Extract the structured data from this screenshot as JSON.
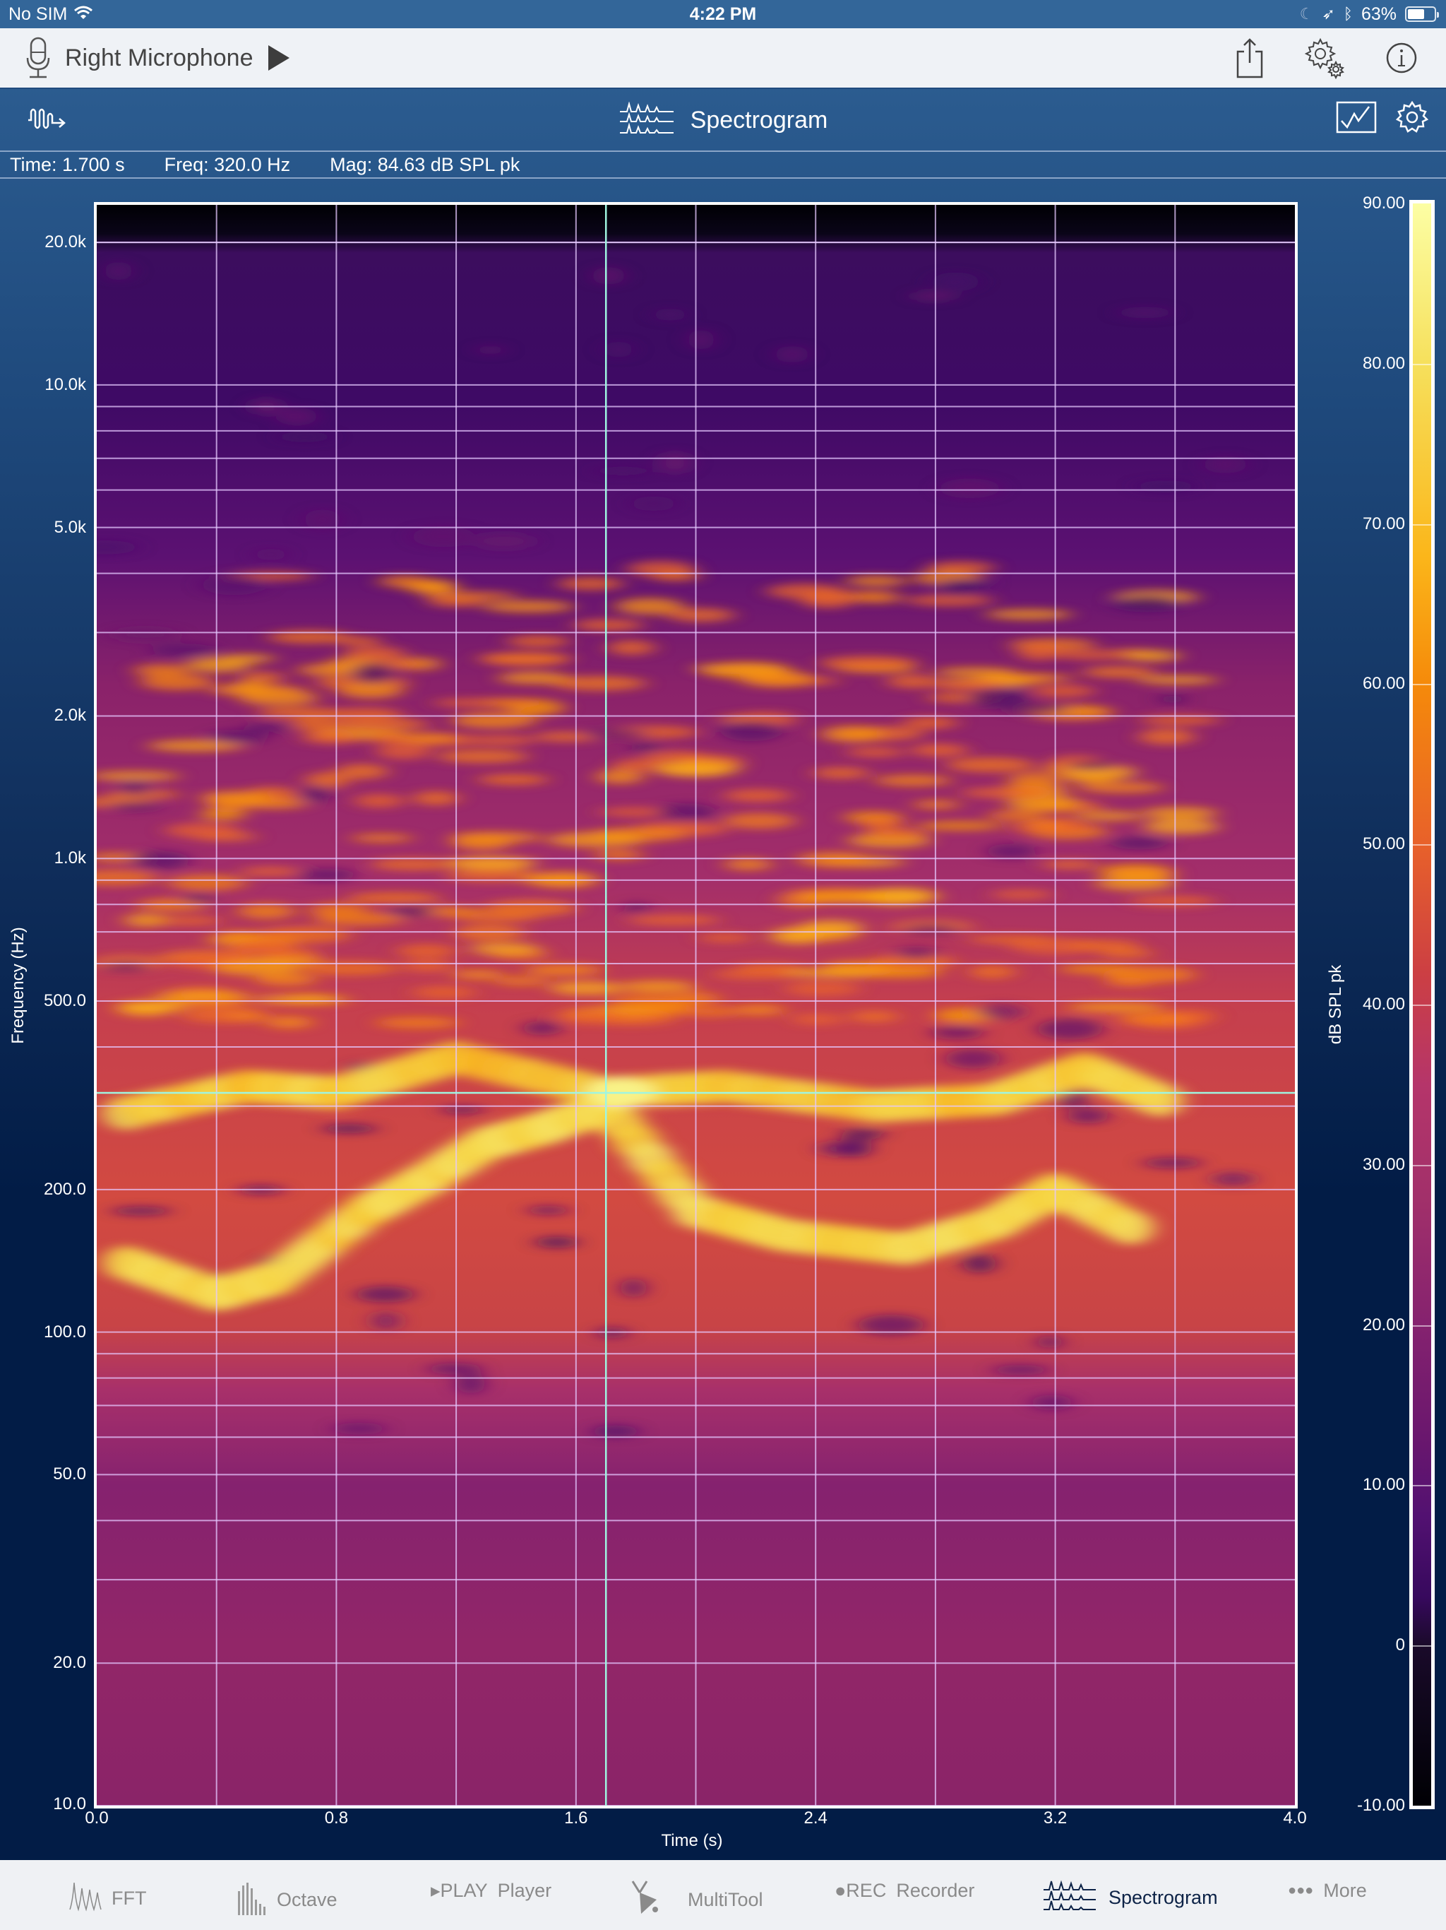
{
  "status_bar": {
    "carrier": "No SIM",
    "time": "4:22 PM",
    "battery_percent_label": "63%",
    "battery_level": 0.63
  },
  "toolbar": {
    "source_label": "Right Microphone",
    "icons": [
      "microphone-icon",
      "play-icon",
      "share-icon",
      "settings-gears-icon",
      "info-icon"
    ]
  },
  "header": {
    "title": "Spectrogram",
    "icons": [
      "waveform-input-icon",
      "spectrogram-icon",
      "chart-mode-icon",
      "gear-icon"
    ]
  },
  "readout": {
    "time": "Time: 1.700 s",
    "freq": "Freq: 320.0 Hz",
    "mag": "Mag: 84.63 dB SPL pk"
  },
  "chart_data": {
    "type": "heatmap",
    "title": "Spectrogram",
    "xlabel": "Time (s)",
    "ylabel": "Frequency (Hz)",
    "xlim": [
      0.0,
      4.0
    ],
    "ylim": [
      10.0,
      24000
    ],
    "yscale": "log",
    "x_ticks": [
      "0.0",
      "0.8",
      "1.6",
      "2.4",
      "3.2",
      "4.0"
    ],
    "x_tick_values": [
      0.0,
      0.8,
      1.6,
      2.4,
      3.2,
      4.0
    ],
    "x_minor_grid": [
      0.4,
      1.2,
      2.0,
      2.8,
      3.6
    ],
    "y_ticks": [
      "20.0k",
      "10.0k",
      "5.0k",
      "2.0k",
      "1.0k",
      "500.0",
      "200.0",
      "100.0",
      "50.0",
      "20.0",
      "10.0"
    ],
    "y_tick_values": [
      20000,
      10000,
      5000,
      2000,
      1000,
      500,
      200,
      100,
      50,
      20,
      10
    ],
    "grid": true,
    "colorbar": {
      "label": "dB SPL pk",
      "range": [
        -10,
        90
      ],
      "ticks": [
        "90.00",
        "80.00",
        "70.00",
        "60.00",
        "50.00",
        "40.00",
        "30.00",
        "20.00",
        "10.00",
        "0",
        "-10.00"
      ],
      "tick_values": [
        90,
        80,
        70,
        60,
        50,
        40,
        30,
        20,
        10,
        0,
        -10
      ],
      "colormap": "inferno",
      "placement": "right"
    },
    "cursor": {
      "time": 1.7,
      "freq": 320.0,
      "mag_db": 84.63
    },
    "features": [
      {
        "desc": "fundamental pitch contour (bright)",
        "points": [
          [
            0.1,
            140
          ],
          [
            0.4,
            120
          ],
          [
            0.6,
            130
          ],
          [
            0.9,
            180
          ],
          [
            1.1,
            210
          ],
          [
            1.3,
            250
          ],
          [
            1.5,
            270
          ],
          [
            1.7,
            300
          ],
          [
            2.0,
            180
          ],
          [
            2.3,
            160
          ],
          [
            2.7,
            150
          ],
          [
            3.0,
            170
          ],
          [
            3.2,
            200
          ],
          [
            3.5,
            160
          ]
        ],
        "level_db": 78
      },
      {
        "desc": "second harmonic band",
        "points": [
          [
            0.1,
            290
          ],
          [
            0.5,
            330
          ],
          [
            0.8,
            320
          ],
          [
            1.2,
            380
          ],
          [
            1.7,
            320
          ],
          [
            2.1,
            330
          ],
          [
            2.6,
            300
          ],
          [
            3.0,
            310
          ],
          [
            3.3,
            360
          ],
          [
            3.6,
            300
          ]
        ],
        "level_db": 75
      },
      {
        "desc": "mid harmonics 500Hz-3kHz",
        "level_db": 58
      },
      {
        "desc": "high-freq noise 5k-20k",
        "level_db": 30
      },
      {
        "desc": "low-freq region below 100Hz",
        "level_db": 25
      }
    ]
  },
  "tabbar": {
    "tabs": [
      {
        "label": "FFT",
        "icon": "fft-icon",
        "active": false
      },
      {
        "label": "Octave",
        "icon": "octave-icon",
        "active": false
      },
      {
        "label": "Player",
        "icon": "play-badge-icon",
        "badge": "▸PLAY",
        "active": false
      },
      {
        "label": "MultiTool",
        "icon": "multitool-icon",
        "active": false
      },
      {
        "label": "Recorder",
        "icon": "rec-badge-icon",
        "badge": "●REC",
        "active": false
      },
      {
        "label": "Spectrogram",
        "icon": "spectrogram-icon",
        "active": true
      },
      {
        "label": "More",
        "icon": "more-dots-icon",
        "badge": "●●●",
        "active": false
      }
    ]
  },
  "colors": {
    "status_bar": "#336699",
    "toolbar_bg": "#eff2f6",
    "header_blue": "#2f6195",
    "plot_bg_navy": "#021c46",
    "tab_active": "#0d2347",
    "tab_inactive": "#8a8a8a",
    "cursor_color": "#9ff5e0"
  }
}
